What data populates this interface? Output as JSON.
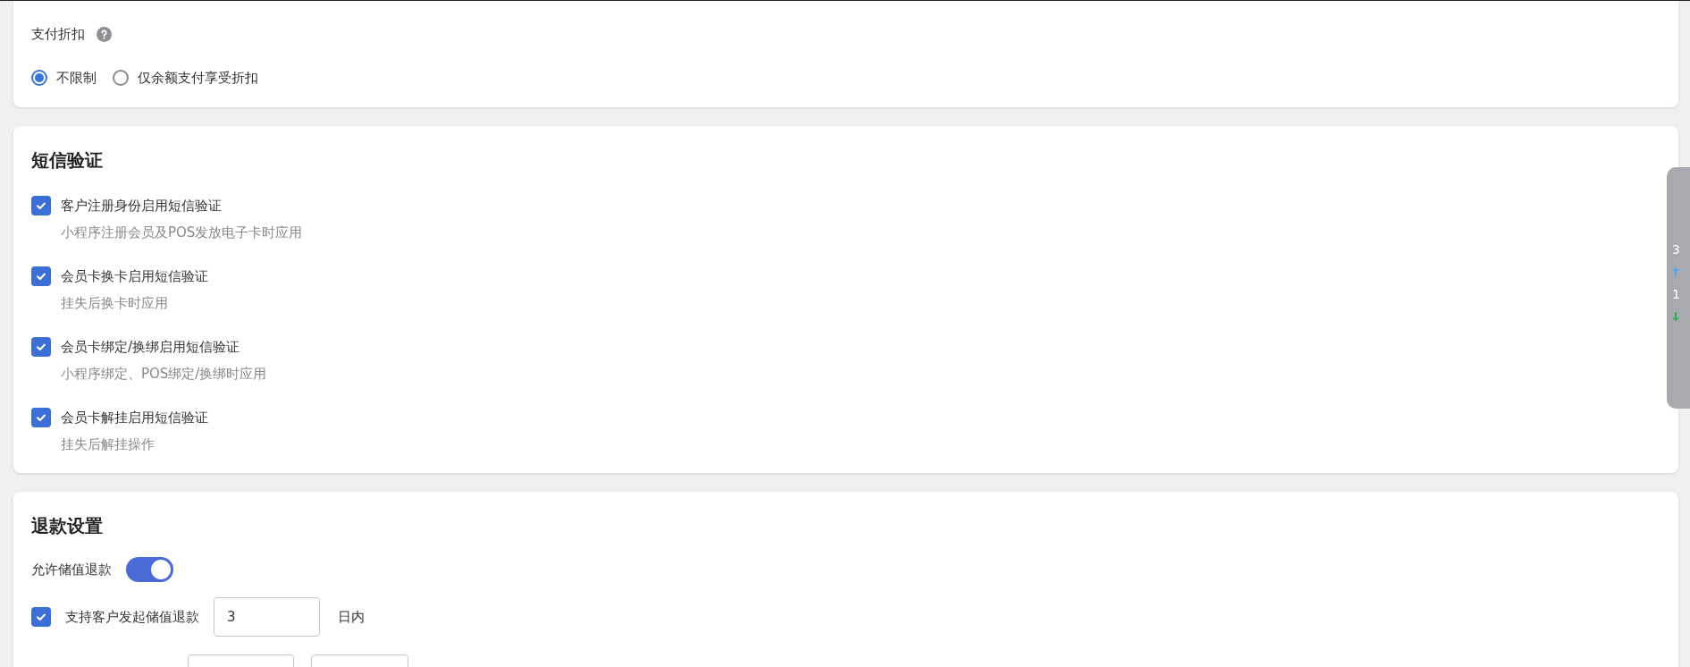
{
  "discount": {
    "label": "支付折扣",
    "options": [
      {
        "label": "不限制",
        "selected": true
      },
      {
        "label": "仅余额支付享受折扣",
        "selected": false
      }
    ]
  },
  "sms": {
    "title": "短信验证",
    "items": [
      {
        "label": "客户注册身份启用短信验证",
        "description": "小程序注册会员及POS发放电子卡时应用",
        "checked": true
      },
      {
        "label": "会员卡换卡启用短信验证",
        "description": "挂失后换卡时应用",
        "checked": true
      },
      {
        "label": "会员卡绑定/换绑启用短信验证",
        "description": "小程序绑定、POS绑定/换绑时应用",
        "checked": true
      },
      {
        "label": "会员卡解挂启用短信验证",
        "description": "挂失后解挂操作",
        "checked": true
      }
    ]
  },
  "refund": {
    "title": "退款设置",
    "allow": {
      "label": "允许储值退款",
      "on": true
    },
    "customer_refund": {
      "label": "支持客户发起储值退款",
      "checked": true,
      "value": "3",
      "suffix": "日内"
    },
    "next_row": [
      {
        "kind": "field"
      },
      {
        "kind": "field"
      }
    ]
  },
  "side_widget": {
    "readings": [
      "3",
      "1"
    ]
  }
}
